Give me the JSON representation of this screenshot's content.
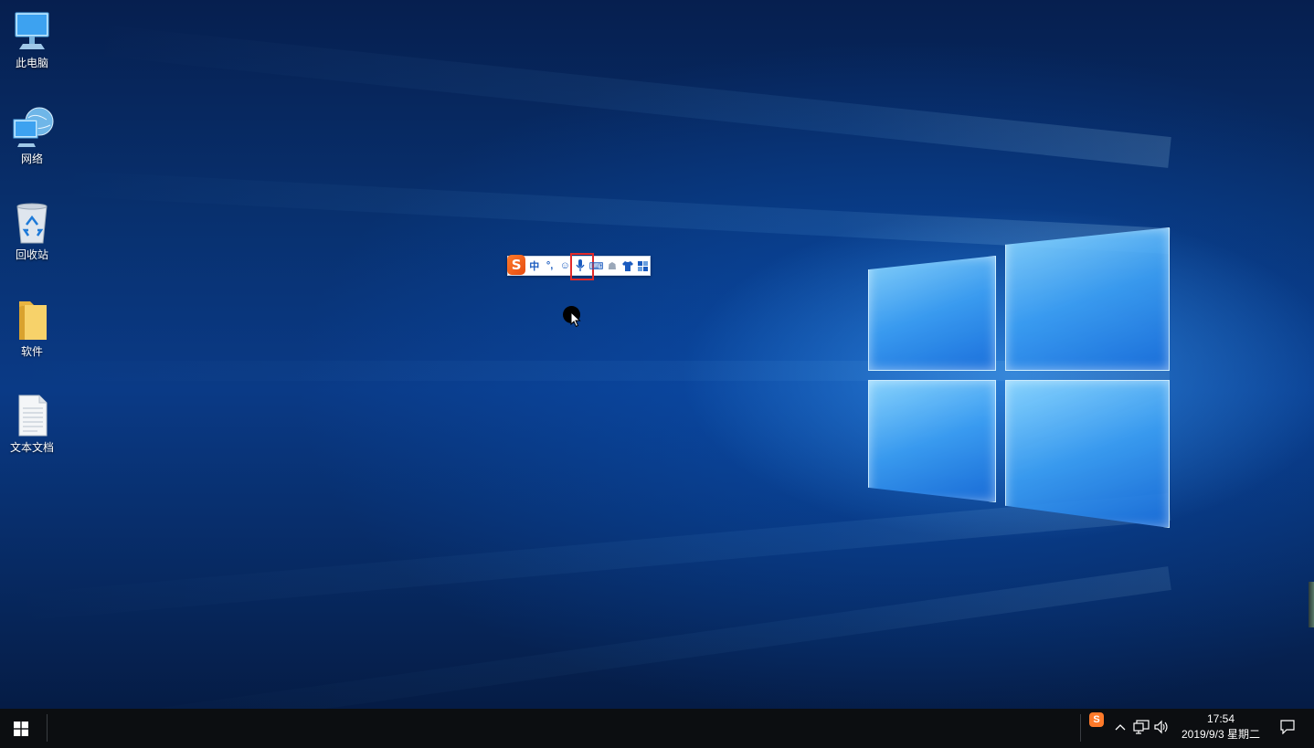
{
  "desktop": {
    "icons": [
      {
        "label": "此电脑",
        "icon": "computer-icon"
      },
      {
        "label": "网络",
        "icon": "network-icon"
      },
      {
        "label": "回收站",
        "icon": "recycle-bin-icon"
      },
      {
        "label": "软件",
        "icon": "folder-icon"
      },
      {
        "label": "文本文档",
        "icon": "text-document-icon"
      }
    ]
  },
  "ime_toolbar": {
    "logo": "S",
    "items": [
      {
        "label": "中",
        "icon": "chinese-mode-icon"
      },
      {
        "label": "°,",
        "icon": "punctuation-icon"
      },
      {
        "label": "☺",
        "icon": "emoji-icon"
      },
      {
        "label": "🎤",
        "icon": "microphone-icon",
        "highlighted": true
      },
      {
        "label": "⌨",
        "icon": "keyboard-icon"
      },
      {
        "label": "☗",
        "icon": "user-icon"
      },
      {
        "label": "👕",
        "icon": "skin-icon"
      },
      {
        "label": "▦",
        "icon": "toolbox-icon"
      }
    ],
    "highlight_color": "#e32a2a"
  },
  "taskbar": {
    "tray": {
      "ime_icon": "S",
      "chevron": "^",
      "network_icon": "network-icon",
      "volume_icon": "volume-icon"
    },
    "clock": {
      "time": "17:54",
      "date": "2019/9/3 星期二"
    },
    "notification_icon": "action-center-icon"
  },
  "colors": {
    "accent": "#1a5bbf",
    "taskbar_bg": "#0c0e11",
    "sogou_orange": "#ff7a2a"
  }
}
